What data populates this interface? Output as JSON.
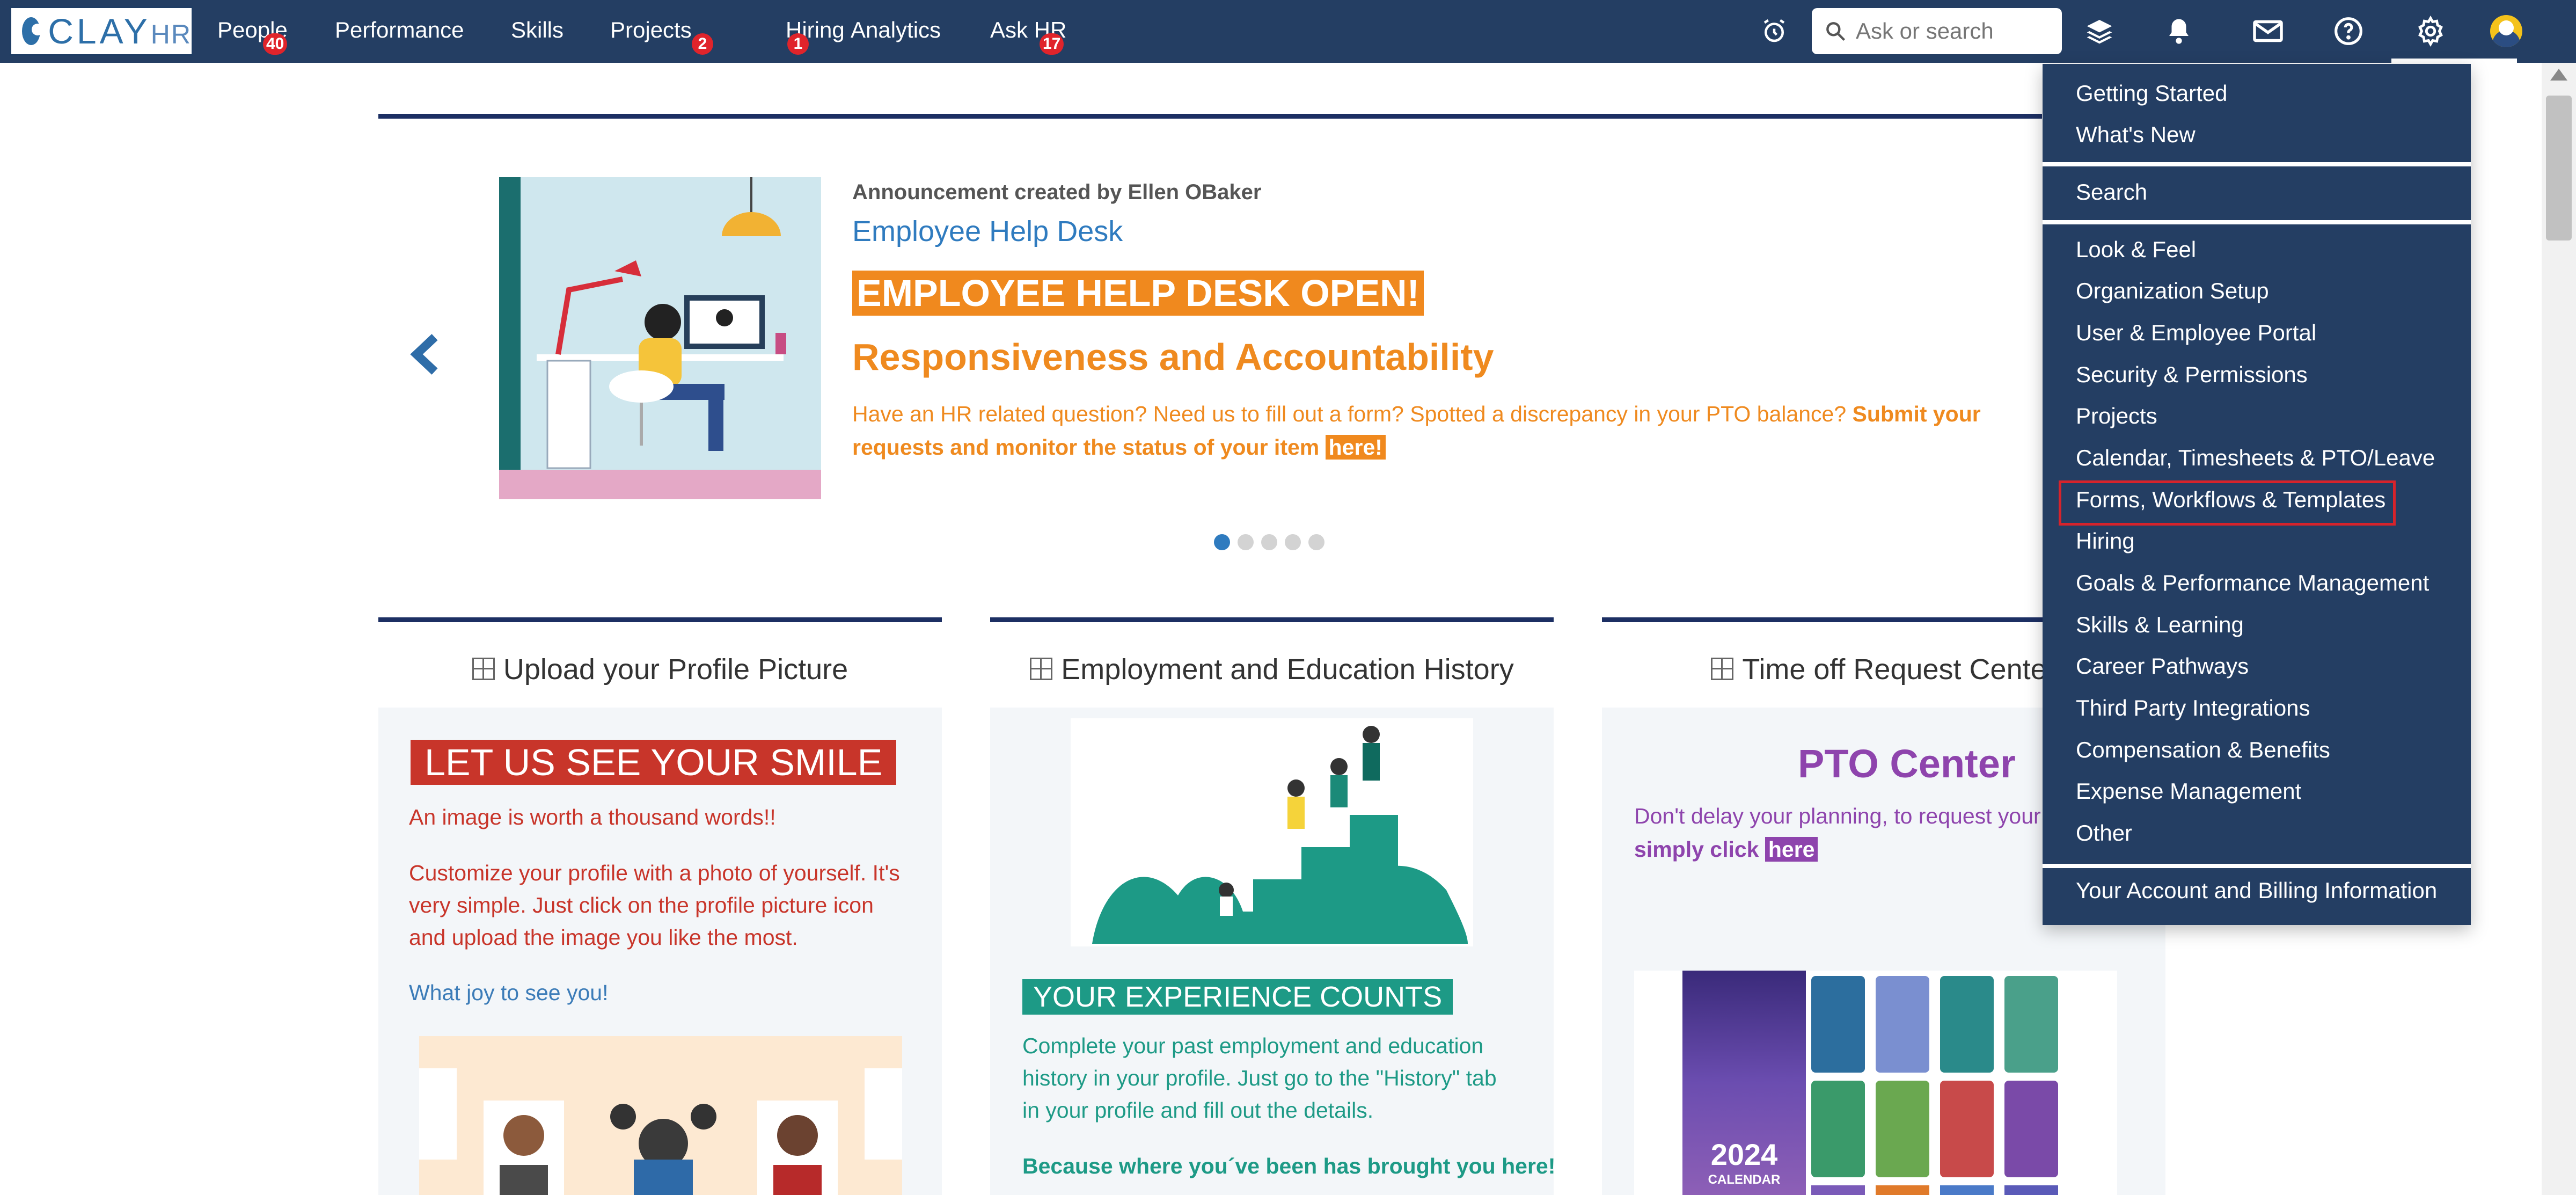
{
  "nav": {
    "logo_text": "CLAY",
    "logo_suffix": "HR",
    "items": [
      {
        "label": "People",
        "badge": "40"
      },
      {
        "label": "Performance",
        "badge": ""
      },
      {
        "label": "Skills",
        "badge": ""
      },
      {
        "label": "Projects",
        "badge": "2"
      },
      {
        "label": "Hiring",
        "badge": "1"
      },
      {
        "label": "Analytics",
        "badge": ""
      },
      {
        "label": "Ask HR",
        "badge": "17"
      }
    ],
    "search_placeholder": "Ask or search",
    "icons": [
      "alarm-clock-icon",
      "search-icon",
      "layers-icon",
      "bell-icon",
      "envelope-icon",
      "help-icon",
      "gear-icon",
      "avatar"
    ]
  },
  "announcement": {
    "author_line": "Announcement created by Ellen OBaker",
    "title": "Employee Help Desk",
    "headline": "EMPLOYEE HELP DESK OPEN!",
    "subheadline": "Responsiveness and Accountability",
    "body": "Have an HR related question? Need us to fill out a form? Spotted a discrepancy in your PTO balance?",
    "body_bold": "Submit your requests and monitor the status of your item",
    "link_text": "here!",
    "carousel_dots": 5,
    "active_dot": 1
  },
  "cards": [
    {
      "title": "Upload your Profile Picture",
      "headline": "LET US SEE YOUR SMILE",
      "line1": "An image is worth a thousand words!!",
      "para1": "Customize your profile with a photo of yourself. It's",
      "para2": "very simple. Just click on the profile picture icon",
      "para3": "and upload the image you like the most.",
      "joy": "What joy to see you!"
    },
    {
      "title": "Employment and Education History",
      "headline": "YOUR EXPERIENCE COUNTS",
      "para1": "Complete your past employment and education",
      "para2": "history in your profile. Just go to the \"History\" tab",
      "para3": "in your profile and fill out the details.",
      "bold_line": "Because where you´ve been has brought you here!"
    },
    {
      "title": "Time off Request Center",
      "headline": "PTO Center",
      "para1": "Don't delay your planning, to request your",
      "para2_prefix": "simply click",
      "link_text": "here",
      "calendar_year": "2024",
      "calendar_label": "CALENDAR"
    }
  ],
  "settings_menu": {
    "groups": [
      [
        "Getting Started",
        "What's New"
      ],
      [
        "Search"
      ],
      [
        "Look & Feel",
        "Organization Setup",
        "User & Employee Portal",
        "Security & Permissions",
        "Projects",
        "Calendar, Timesheets & PTO/Leave",
        "Forms, Workflows & Templates",
        "Hiring",
        "Goals & Performance Management",
        "Skills & Learning",
        "Career Pathways",
        "Third Party Integrations",
        "Compensation & Benefits",
        "Expense Management",
        "Other"
      ],
      [
        "Your Account and Billing Information"
      ]
    ],
    "highlighted": "Forms, Workflows & Templates"
  },
  "colors": {
    "nav_bg": "#243e63",
    "accent_blue": "#2f7bbf",
    "orange": "#f0891e",
    "red": "#c8352a",
    "teal": "#1d9a86",
    "purple": "#8e44ad",
    "highlight_border": "#d7232b"
  }
}
